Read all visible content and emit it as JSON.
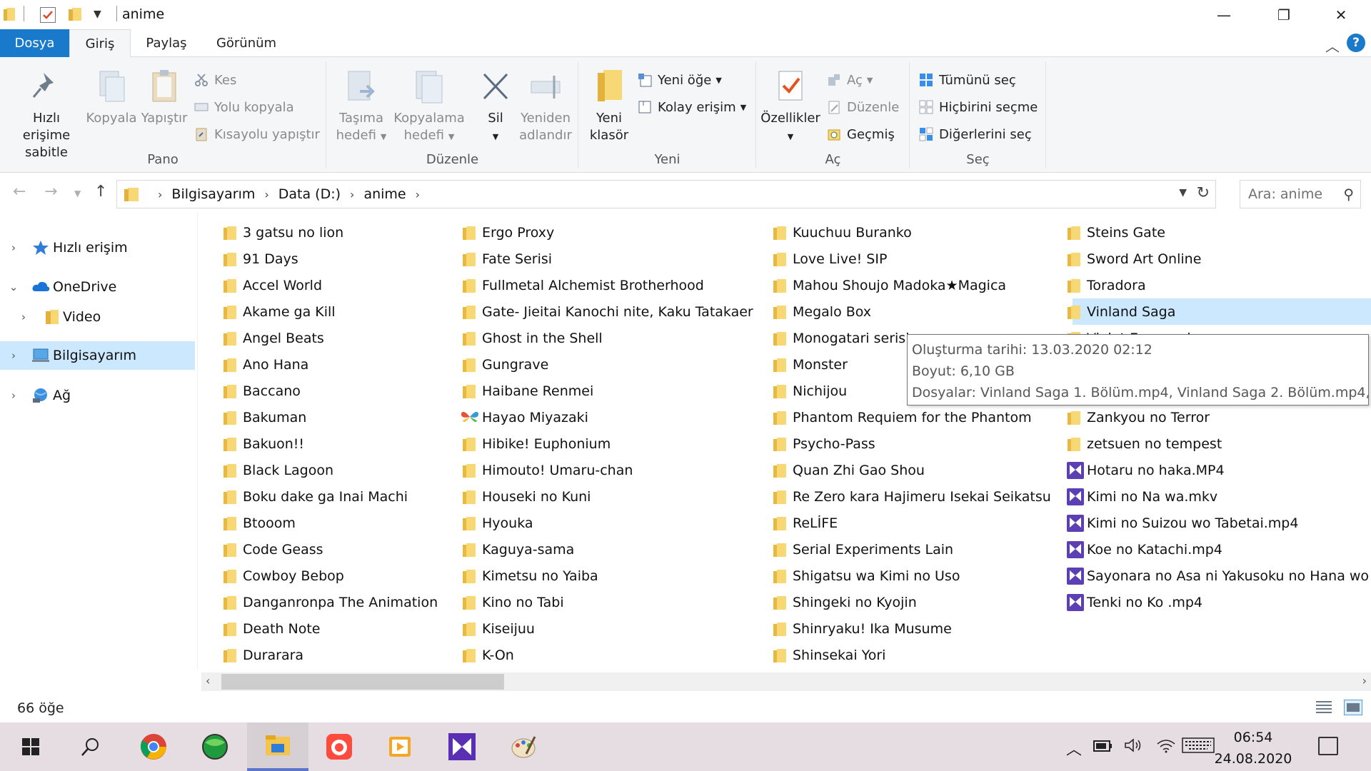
{
  "window": {
    "title": "anime",
    "minimize_glyph": "—",
    "restore_glyph": "❐",
    "close_glyph": "✕"
  },
  "ribbon_tabs": {
    "file": "Dosya",
    "home": "Giriş",
    "share": "Paylaş",
    "view": "Görünüm",
    "help": "?"
  },
  "ribbon": {
    "pano": {
      "label": "Pano",
      "pin_line1": "Hızlı erişime",
      "pin_line2": "sabitle",
      "copy": "Kopyala",
      "paste": "Yapıştır",
      "cut": "Kes",
      "copy_path": "Yolu kopyala",
      "paste_shortcut": "Kısayolu yapıştır"
    },
    "duzenle": {
      "label": "Düzenle",
      "move_line1": "Taşıma",
      "move_line2": "hedefi",
      "copyto_line1": "Kopyalama",
      "copyto_line2": "hedefi",
      "delete": "Sil",
      "rename_line1": "Yeniden",
      "rename_line2": "adlandır"
    },
    "yeni": {
      "label": "Yeni",
      "new_folder_line1": "Yeni",
      "new_folder_line2": "klasör",
      "new_item": "Yeni öğe",
      "easy_access": "Kolay erişim"
    },
    "ac": {
      "label": "Aç",
      "properties": "Özellikler",
      "open": "Aç",
      "edit": "Düzenle",
      "history": "Geçmiş"
    },
    "sec": {
      "label": "Seç",
      "select_all": "Tümünü seç",
      "select_none": "Hiçbirini seçme",
      "invert": "Diğerlerini seç"
    }
  },
  "address": {
    "crumbs": [
      "Bilgisayarım",
      "Data (D:)",
      "anime"
    ],
    "search_placeholder": "Ara: anime"
  },
  "navpane": {
    "items": [
      {
        "label": "Hızlı erişim",
        "icon": "star-icon"
      },
      {
        "label": "OneDrive",
        "icon": "cloud-icon"
      },
      {
        "label": "Video",
        "icon": "folder-icon"
      },
      {
        "label": "Bilgisayarım",
        "icon": "computer-icon"
      },
      {
        "label": "Ağ",
        "icon": "network-icon"
      }
    ]
  },
  "files": {
    "col1": [
      "3 gatsu no lion",
      "91 Days",
      "Accel World",
      "Akame ga Kill",
      "Angel Beats",
      "Ano Hana",
      "Baccano",
      "Bakuman",
      "Bakuon!!",
      "Black Lagoon",
      "Boku dake ga Inai Machi",
      "Btooom",
      "Code Geass",
      "Cowboy Bebop",
      "Danganronpa The Animation",
      "Death Note",
      "Durarara"
    ],
    "col2": [
      "Ergo Proxy",
      "Fate Serisi",
      "Fullmetal Alchemist Brotherhood",
      "Gate- Jieitai Kanochi nite, Kaku Tatakaer",
      "Ghost in the Shell",
      "Gungrave",
      "Haibane Renmei",
      "Hayao Miyazaki",
      "Hibike! Euphonium",
      "Himouto! Umaru-chan",
      "Houseki no Kuni",
      "Hyouka",
      "Kaguya-sama",
      "Kimetsu no Yaiba",
      "Kino no Tabi",
      "Kiseijuu",
      "K-On"
    ],
    "col3": [
      "Kuuchuu Buranko",
      "Love Live! SIP",
      "Mahou Shoujo Madoka★Magica",
      "Megalo Box",
      "Monogatari serisi",
      "Monster",
      "Nichijou",
      "Phantom Requiem for the Phantom",
      "Psycho-Pass",
      "Quan Zhi Gao Shou",
      "Re Zero kara Hajimeru Isekai Seikatsu",
      "ReLİFE",
      "Serial Experiments Lain",
      "Shigatsu wa Kimi no Uso",
      "Shingeki no Kyojin",
      "Shinryaku! Ika Musume",
      "Shinsekai Yori"
    ],
    "col4": [
      "Steins Gate",
      "Sword Art Online",
      "Toradora",
      "Vinland Saga",
      "Violet Evergarden",
      "",
      "",
      "Zankyou no Terror",
      "zetsuen no tempest",
      "Hotaru no haka.MP4",
      "Kimi no Na wa.mkv",
      "Kimi no Suizou wo Tabetai.mp4",
      "Koe no Katachi.mp4",
      "Sayonara no Asa ni Yakusoku no Hana wo",
      "Tenki no Ko .mp4"
    ]
  },
  "tooltip": {
    "created": "Oluşturma tarihi: 13.03.2020 02:12",
    "size": "Boyut: 6,10 GB",
    "files": "Dosyalar: Vinland Saga 1. Bölüm.mp4, Vinland Saga 2. Bölüm.mp4, ..."
  },
  "status": {
    "count": "66 öğe"
  },
  "taskbar": {
    "time": "06:54",
    "date": "24.08.2020"
  }
}
